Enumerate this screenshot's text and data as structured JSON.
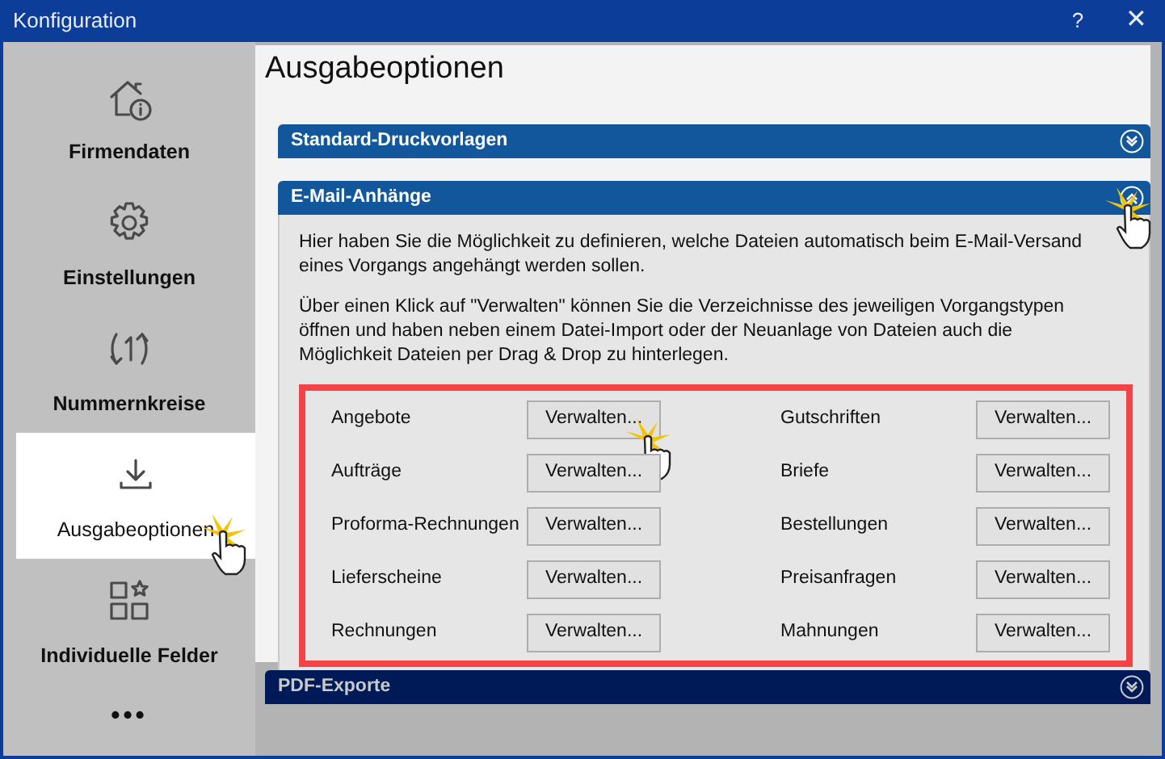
{
  "window": {
    "title": "Konfiguration",
    "buttons": [
      {
        "kind": "help",
        "label": "?"
      },
      {
        "kind": "close",
        "label": "✕"
      }
    ]
  },
  "sidebar": {
    "items": [
      {
        "kind": "house-info",
        "label": "Firmendaten",
        "selected": false,
        "cursor": false
      },
      {
        "kind": "gear",
        "label": "Einstellungen",
        "selected": false,
        "cursor": false
      },
      {
        "kind": "counter",
        "label": "Nummernkreise",
        "selected": false,
        "cursor": false
      },
      {
        "kind": "download",
        "label": "Ausgabeoptionen",
        "selected": true,
        "cursor": true
      },
      {
        "kind": "grid-star",
        "label": "Individuelle Felder",
        "selected": false,
        "cursor": false
      },
      {
        "kind": "more",
        "label": "•••",
        "selected": false,
        "cursor": false
      }
    ]
  },
  "heading": "Ausgabeoptionen",
  "sections": [
    {
      "title": "Standard-Druckvorlagen",
      "expanded": false,
      "dimmed": false,
      "cursor": false
    },
    {
      "title": "E-Mail-Anhänge",
      "expanded": true,
      "dimmed": false,
      "cursor": true,
      "paragraphs": [
        "Hier haben Sie die Möglichkeit zu definieren, welche Dateien automatisch beim E-Mail-Versand eines Vorgangs angehängt werden sollen.",
        "Über einen Klick auf \"Verwalten\" können Sie die Verzeichnisse des jeweiligen Vorgangstypen öffnen und haben neben einem Datei-Import oder der Neuanlage von Dateien auch die Möglichkeit Dateien per Drag & Drop zu hinterlegen."
      ],
      "highlighted": true,
      "rows": [
        {
          "label": "Angebote",
          "button": "Verwalten...",
          "cursor": true
        },
        {
          "label": "Gutschriften",
          "button": "Verwalten...",
          "cursor": false
        },
        {
          "label": "Aufträge",
          "button": "Verwalten...",
          "cursor": false
        },
        {
          "label": "Briefe",
          "button": "Verwalten...",
          "cursor": false
        },
        {
          "label": "Proforma-Rechnungen",
          "button": "Verwalten...",
          "cursor": false
        },
        {
          "label": "Bestellungen",
          "button": "Verwalten...",
          "cursor": false
        },
        {
          "label": "Lieferscheine",
          "button": "Verwalten...",
          "cursor": false
        },
        {
          "label": "Preisanfragen",
          "button": "Verwalten...",
          "cursor": false
        },
        {
          "label": "Rechnungen",
          "button": "Verwalten...",
          "cursor": false
        },
        {
          "label": "Mahnungen",
          "button": "Verwalten...",
          "cursor": false
        }
      ]
    },
    {
      "title": "PDF-Exporte",
      "expanded": false,
      "dimmed": true,
      "cursor": false
    }
  ]
}
